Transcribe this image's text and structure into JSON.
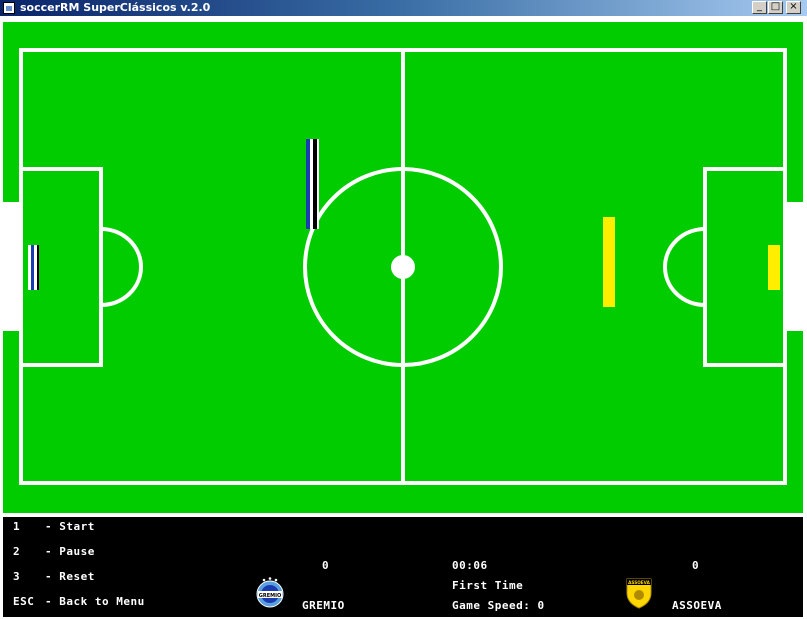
{
  "window": {
    "title": "soccerRM SuperClássicos v.2.0",
    "minimize_label": "_",
    "maximize_label": "□",
    "close_label": "×"
  },
  "pitch": {
    "grass_color": "#00cc00",
    "line_color": "#ffffff"
  },
  "players": {
    "home": {
      "name": "GREMIO",
      "colors": [
        "#ffffff",
        "#000000",
        "#1a3cb0"
      ]
    },
    "away": {
      "name": "ASSOEVA",
      "color": "#ffee00"
    }
  },
  "controls": [
    {
      "key": "1",
      "label": "- Start"
    },
    {
      "key": "2",
      "label": "- Pause"
    },
    {
      "key": "3",
      "label": "- Reset"
    },
    {
      "key": "ESC",
      "label": "- Back to Menu"
    }
  ],
  "scoreboard": {
    "home_score": "0",
    "away_score": "0",
    "clock": "00:06",
    "period": "First Time",
    "game_speed": "Game Speed: 0",
    "home_team": "GREMIO",
    "away_team": "ASSOEVA",
    "home_badge_text": "GREMIO",
    "away_badge_text": "ASSOEVA"
  }
}
